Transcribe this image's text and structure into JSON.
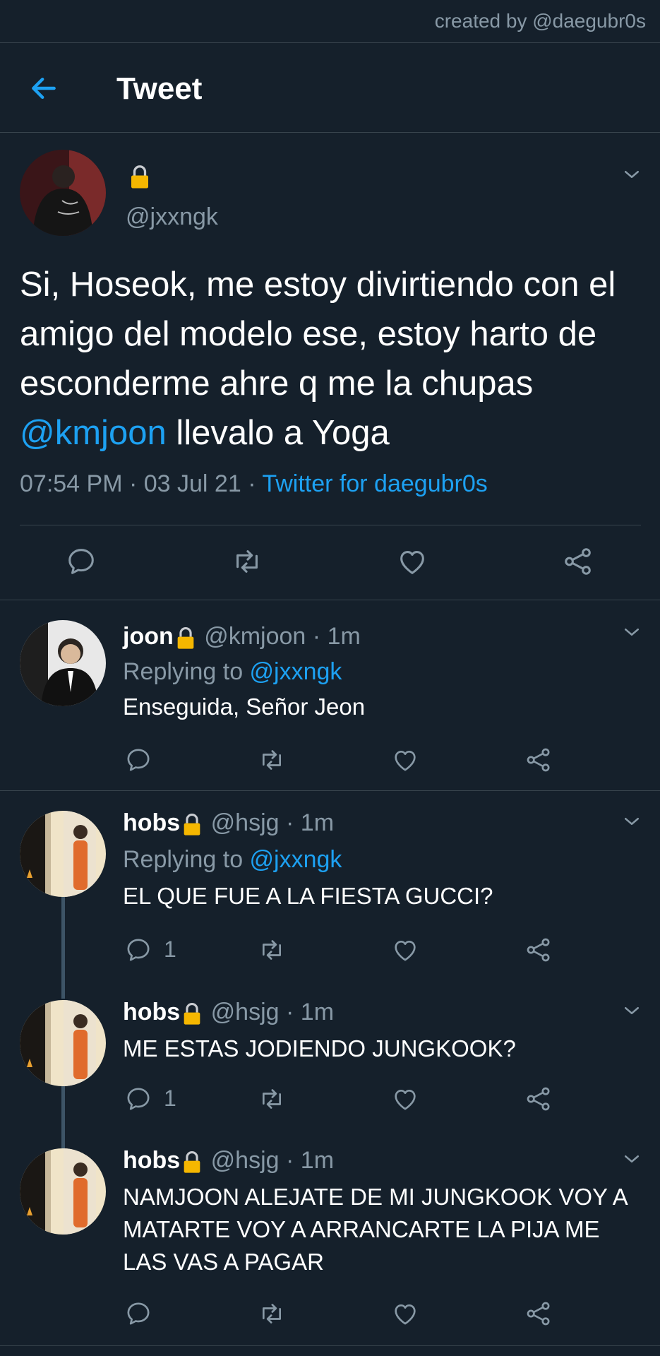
{
  "credit": "created by @daegubr0s",
  "header": {
    "title": "Tweet"
  },
  "main_tweet": {
    "handle": "@jxxngk",
    "text_before_mention": "Si, Hoseok, me estoy divirtiendo con el amigo del modelo ese, estoy harto de esconderme ahre q me la chupas ",
    "mention": "@kmjoon",
    "text_after_mention": " llevalo a Yoga",
    "time": "07:54 PM",
    "date": "03 Jul 21",
    "separator": " · ",
    "source": "Twitter for daegubr0s"
  },
  "replies": [
    {
      "name": "joon",
      "handle": "@kmjoon",
      "time": "1m",
      "replying_label": "Replying to ",
      "replying_to": "@jxxngk",
      "text": "Enseguida, Señor Jeon",
      "reply_count": ""
    },
    {
      "name": "hobs",
      "handle": "@hsjg",
      "time": "1m",
      "replying_label": "Replying to ",
      "replying_to": "@jxxngk",
      "text": "EL QUE FUE A LA FIESTA GUCCI?",
      "reply_count": "1"
    },
    {
      "name": "hobs",
      "handle": "@hsjg",
      "time": "1m",
      "text": "ME ESTAS JODIENDO JUNGKOOK?",
      "reply_count": "1"
    },
    {
      "name": "hobs",
      "handle": "@hsjg",
      "time": "1m",
      "text": "NAMJOON ALEJATE DE MI JUNGKOOK VOY A MATARTE VOY A ARRANCARTE LA PIJA ME LAS VAS A PAGAR",
      "reply_count": ""
    }
  ],
  "colors": {
    "background": "#15202b",
    "accent": "#1da1f2",
    "muted": "#8899a6",
    "divider": "#38444d",
    "lock": "#f5b700"
  },
  "icons": [
    "back-arrow-icon",
    "lock-icon",
    "chevron-down-icon",
    "reply-icon",
    "retweet-icon",
    "like-icon",
    "share-icon"
  ]
}
